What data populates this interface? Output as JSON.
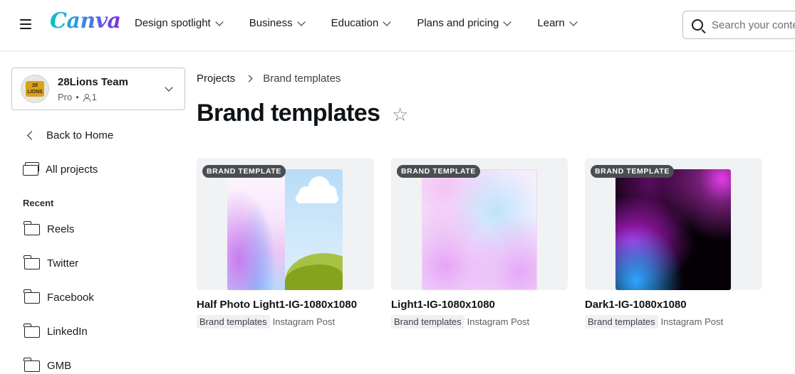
{
  "brand": {
    "logo_text": "Canva"
  },
  "nav": {
    "items": [
      {
        "label": "Design spotlight"
      },
      {
        "label": "Business"
      },
      {
        "label": "Education"
      },
      {
        "label": "Plans and pricing"
      },
      {
        "label": "Learn"
      }
    ]
  },
  "search": {
    "placeholder": "Search your content"
  },
  "team": {
    "name": "28Lions Team",
    "plan": "Pro",
    "dot": "•",
    "members": "1",
    "avatar_text": "28 LIONS"
  },
  "sidebar": {
    "back_label": "Back to Home",
    "all_projects_label": "All projects",
    "recent_heading": "Recent",
    "recent_folders": [
      {
        "label": "Reels"
      },
      {
        "label": "Twitter"
      },
      {
        "label": "Facebook"
      },
      {
        "label": "LinkedIn"
      },
      {
        "label": "GMB"
      }
    ]
  },
  "breadcrumb": {
    "parent": "Projects",
    "current": "Brand templates"
  },
  "page": {
    "title": "Brand templates",
    "star_glyph": "☆"
  },
  "cards": [
    {
      "tag": "BRAND TEMPLATE",
      "name": "Half Photo Light1-IG-1080x1080",
      "folder": "Brand templates",
      "type": "Instagram Post"
    },
    {
      "tag": "BRAND TEMPLATE",
      "name": "Light1-IG-1080x1080",
      "folder": "Brand templates",
      "type": "Instagram Post"
    },
    {
      "tag": "BRAND TEMPLATE",
      "name": "Dark1-IG-1080x1080",
      "folder": "Brand templates",
      "type": "Instagram Post"
    }
  ],
  "colors": {
    "logo_gradient_start": "#00c4cc",
    "logo_gradient_end": "#7d2ae8",
    "tag_bg": "#4a4d52",
    "thumb_bg": "#f1f2f4"
  }
}
